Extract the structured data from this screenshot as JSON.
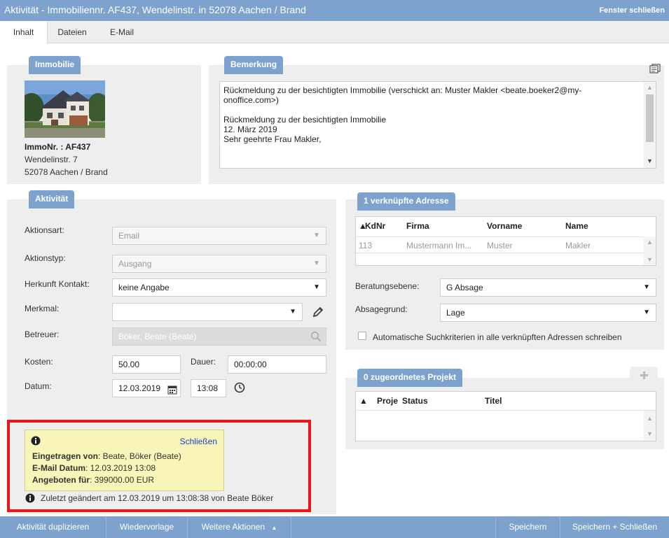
{
  "window": {
    "title": "Aktivität - Immobiliennr. AF437, Wendelinstr. in 52078 Aachen / Brand",
    "close_label": "Fenster schließen"
  },
  "tabs": [
    {
      "label": "Inhalt"
    },
    {
      "label": "Dateien"
    },
    {
      "label": "E-Mail"
    }
  ],
  "immobilie": {
    "heading": "Immobilie",
    "immo_nr": "ImmoNr. : AF437",
    "street": "Wendelinstr. 7",
    "city": "52078 Aachen / Brand"
  },
  "bemerkung": {
    "heading": "Bemerkung",
    "lines": [
      "Rückmeldung zu der besichtigten Immobilie (verschickt an: Muster Makler <beate.boeker2@my-",
      "onoffice.com>)",
      "",
      "Rückmeldung zu der besichtigten Immobilie",
      "12. März 2019",
      "Sehr geehrte Frau Makler,"
    ]
  },
  "aktivitaet": {
    "heading": "Aktivität",
    "aktionsart_label": "Aktionsart:",
    "aktionsart_value": "Email",
    "aktionstyp_label": "Aktionstyp:",
    "aktionstyp_value": "Ausgang",
    "herkunft_label": "Herkunft Kontakt:",
    "herkunft_value": "keine Angabe",
    "merkmal_label": "Merkmal:",
    "merkmal_value": "",
    "betreuer_label": "Betreuer:",
    "betreuer_value": "Böker, Beate (Beate)",
    "kosten_label": "Kosten:",
    "kosten_value": "50.00",
    "dauer_label": "Dauer:",
    "dauer_value": "00:00:00",
    "datum_label": "Datum:",
    "datum_value": "12.03.2019",
    "zeit_value": "13:08"
  },
  "info": {
    "close_label": "Schließen",
    "eingetragen_label": "Eingetragen von",
    "eingetragen_value": ": Beate, Böker (Beate)",
    "email_datum_label": "E-Mail Datum",
    "email_datum_value": ": 12.03.2019 13:08",
    "angeboten_label": "Angeboten für",
    "angeboten_value": ": 399000.00 EUR",
    "last_changed": "Zuletzt geändert am 12.03.2019 um 13:08:38 von Beate Böker"
  },
  "adressen": {
    "heading": "1 verknüpfte Adresse",
    "columns": [
      "KdNr",
      "Firma",
      "Vorname",
      "Name"
    ],
    "rows": [
      [
        "113",
        "Mustermann Im...",
        "Muster",
        "Makler"
      ]
    ],
    "beratungsebene_label": "Beratungsebene:",
    "beratungsebene_value": "G Absage",
    "absagegrund_label": "Absagegrund:",
    "absagegrund_value": "Lage",
    "auto_checkbox_label": "Automatische Suchkriterien in alle verknüpften Adressen schreiben"
  },
  "projekt": {
    "heading": "0 zugeordnetes Projekt",
    "columns": [
      "Proje",
      "Status",
      "Titel"
    ]
  },
  "bottom": {
    "duplicate": "Aktivität duplizieren",
    "wiedervorlage": "Wiedervorlage",
    "weitere": "Weitere Aktionen",
    "speichern": "Speichern",
    "speichern_schliessen": "Speichern + Schließen"
  },
  "colors": {
    "accent": "#7ea2ce",
    "panel": "#eeeeee",
    "info_bg": "#f8f5b8",
    "highlight": "#e8151b"
  }
}
